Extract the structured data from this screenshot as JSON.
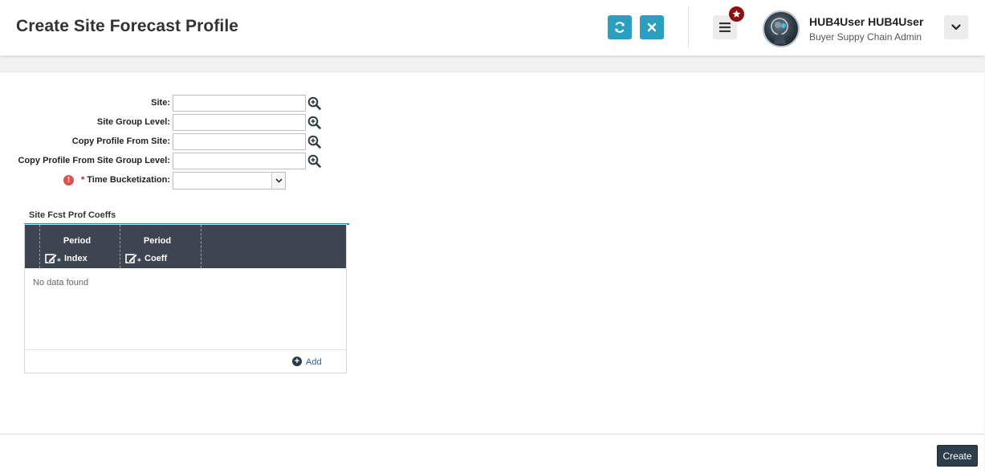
{
  "header": {
    "title": "Create Site Forecast Profile",
    "refresh_icon": "refresh-icon",
    "close_icon": "close-icon",
    "menu_icon": "hamburger-menu-icon",
    "favorites_icon": "star-icon",
    "user_name": "HUB4User HUB4User",
    "user_role": "Buyer Suppy Chain Admin",
    "expand_icon": "chevron-down-icon"
  },
  "form": {
    "site_label": "Site:",
    "site_value": "",
    "site_group_label": "Site Group Level:",
    "site_group_value": "",
    "copy_site_label": "Copy Profile From Site:",
    "copy_site_value": "",
    "copy_site_group_label": "Copy Profile From Site Group Level:",
    "copy_site_group_value": "",
    "time_bucket_required": "*",
    "time_bucket_label": "Time Bucketization:",
    "time_bucket_value": ""
  },
  "grid": {
    "title": "Site Fcst Prof Coeffs",
    "columns": [
      {
        "top": "Period",
        "bottom": "Index"
      },
      {
        "top": "Period",
        "bottom": "Coeff"
      }
    ],
    "empty_text": "No data found",
    "add_label": "Add"
  },
  "footer": {
    "create_label": "Create"
  },
  "colors": {
    "accent": "#2b9fbf",
    "grid_header": "#3d4550",
    "primary_button": "#2c3e4b",
    "badge": "#8b1212",
    "error": "#d9534f"
  }
}
